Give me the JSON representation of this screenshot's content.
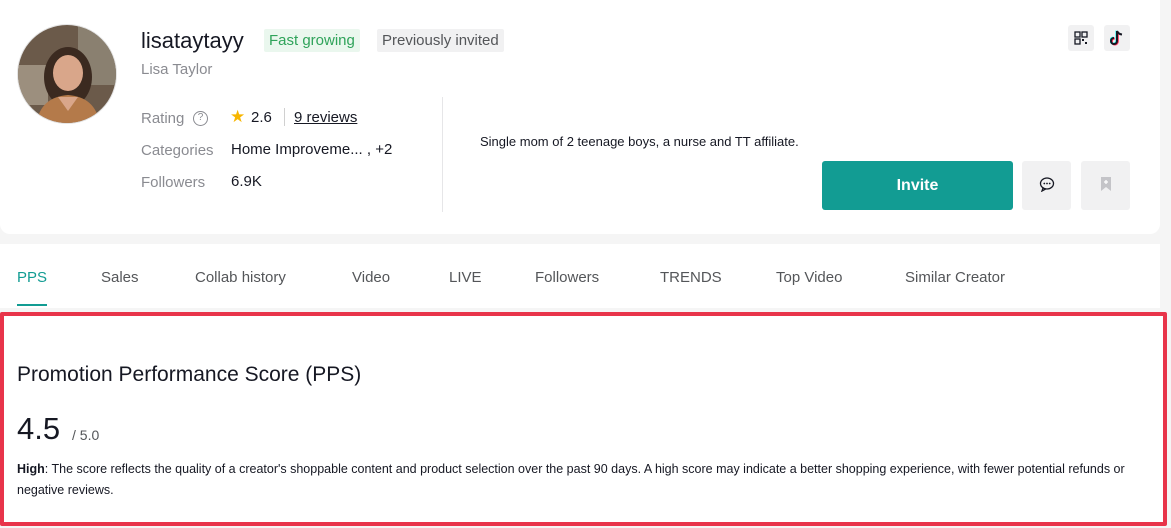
{
  "profile": {
    "handle": "lisataytayy",
    "badges": {
      "fast_growing": "Fast growing",
      "previously_invited": "Previously invited"
    },
    "full_name": "Lisa Taylor",
    "rating_label": "Rating",
    "rating_value": "2.6",
    "reviews_link": "9 reviews",
    "categories_label": "Categories",
    "categories_value": "Home Improveme... , +2",
    "followers_label": "Followers",
    "followers_value": "6.9K",
    "bio": "Single mom of 2 teenage boys, a nurse and TT affiliate.",
    "invite_label": "Invite"
  },
  "tabs": [
    {
      "label": "PPS",
      "active": true
    },
    {
      "label": "Sales"
    },
    {
      "label": "Collab history"
    },
    {
      "label": "Video"
    },
    {
      "label": "LIVE"
    },
    {
      "label": "Followers"
    },
    {
      "label": "TRENDS"
    },
    {
      "label": "Top Video"
    },
    {
      "label": "Similar Creator"
    }
  ],
  "pps": {
    "title": "Promotion Performance Score (PPS)",
    "score": "4.5",
    "max": "/ 5.0",
    "level": "High",
    "description": ": The score reflects the quality of a creator's shoppable content and product selection over the past 90 days. A high score may indicate a better shopping experience, with fewer potential refunds or negative reviews."
  },
  "colors": {
    "accent": "#129c93",
    "highlight_border": "#e8344a",
    "star": "#f7b500",
    "fast_growing": "#2fa35a"
  },
  "icons": [
    "qr-code-icon",
    "tiktok-icon",
    "message-icon",
    "bookmark-icon",
    "star-icon",
    "help-icon"
  ]
}
